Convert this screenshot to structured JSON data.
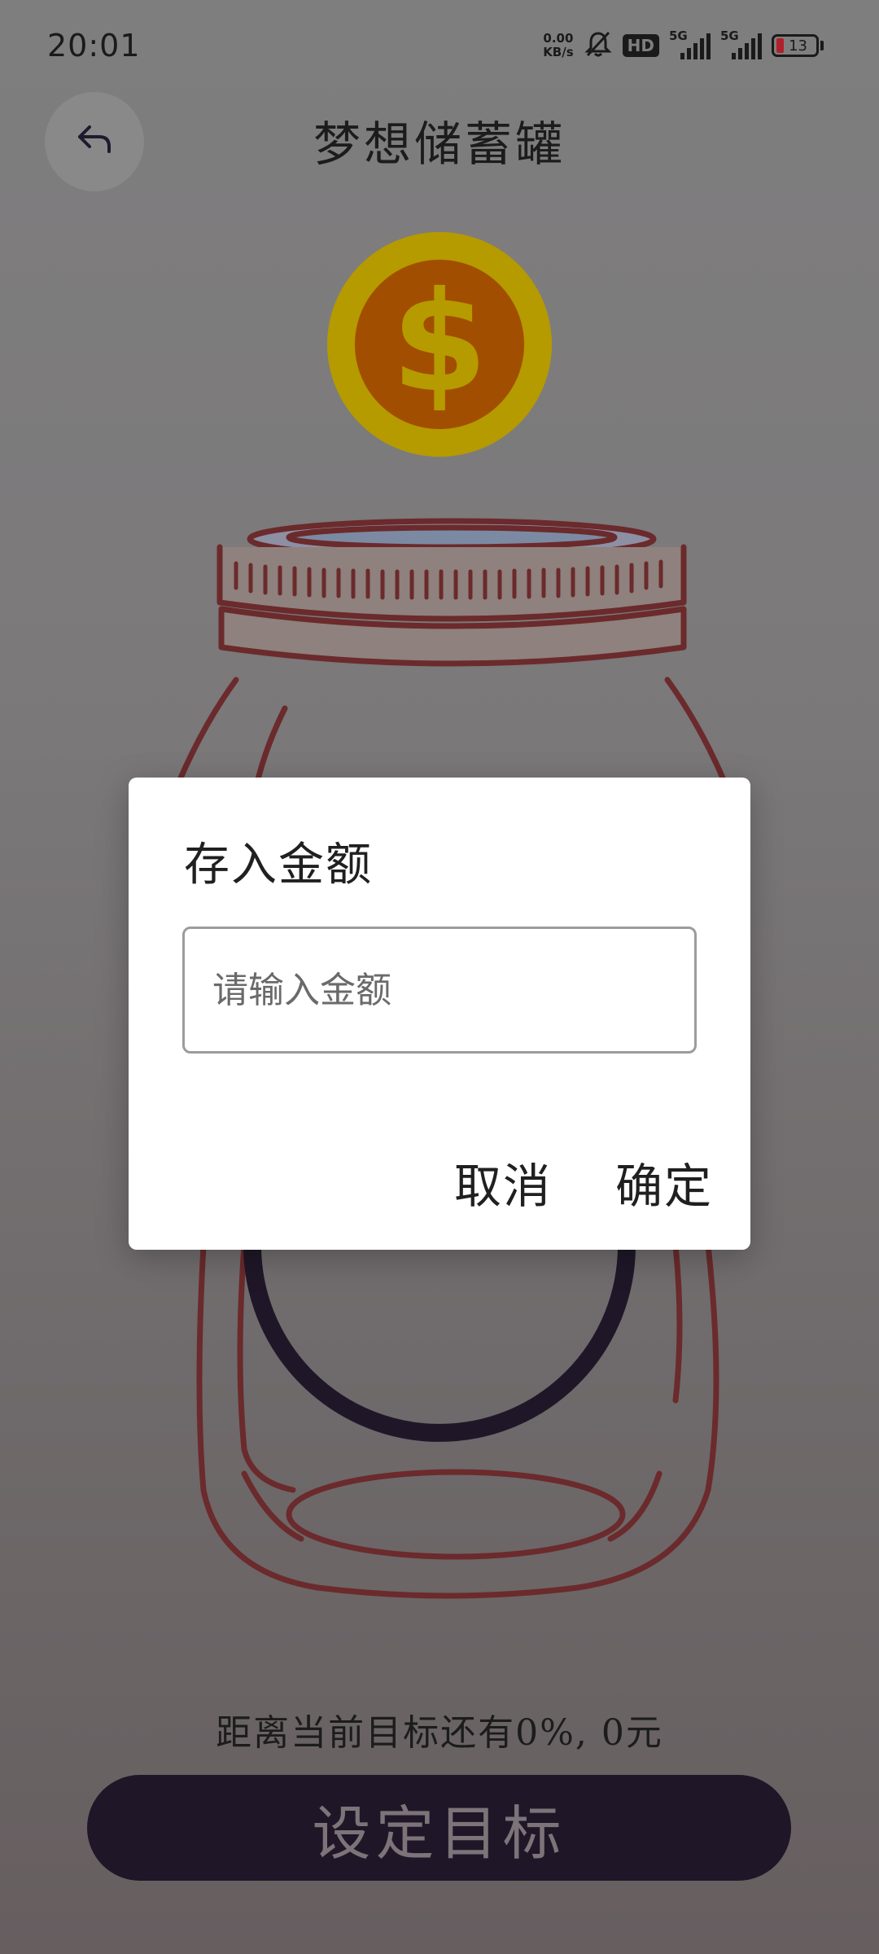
{
  "status_bar": {
    "time": "20:01",
    "net_speed_value": "0.00",
    "net_speed_unit": "KB/s",
    "hd_label": "HD",
    "signal1_label": "5G",
    "signal2_label": "5G",
    "battery_level": "13",
    "icons": [
      "mute-bell-icon",
      "hd-icon",
      "signal-icon",
      "signal-icon",
      "battery-icon"
    ]
  },
  "header": {
    "title": "梦想储蓄罐",
    "back_icon": "back-arrow-icon"
  },
  "illustration": {
    "coin_icon": "dollar-coin-icon",
    "jar_icon": "jar-icon"
  },
  "progress_text": "距离当前目标还有0%, 0元",
  "goal_button_label": "设定目标",
  "dialog": {
    "title": "存入金额",
    "input_placeholder": "请输入金额",
    "input_value": "",
    "cancel_label": "取消",
    "confirm_label": "确定"
  },
  "colors": {
    "overlay_bg": "#7f7e7f",
    "coin_outer": "#b59a00",
    "coin_inner": "#a24e00",
    "jar_outline": "#6b2a2c",
    "button_bg": "#1f1728",
    "dialog_bg": "#ffffff"
  }
}
